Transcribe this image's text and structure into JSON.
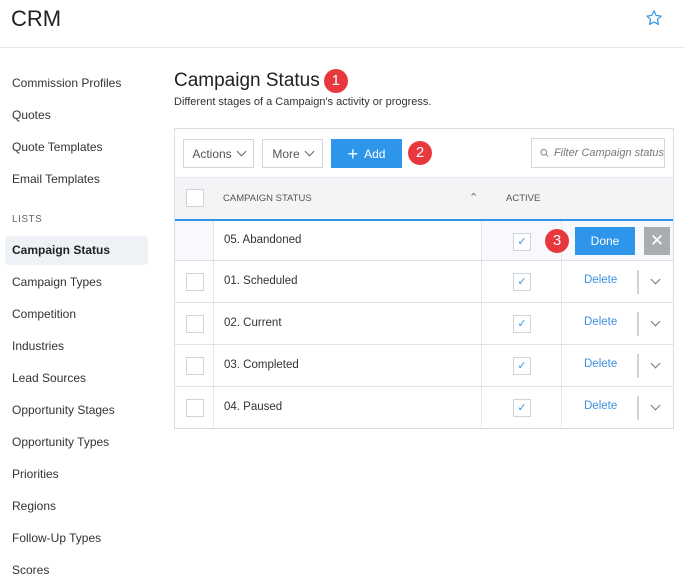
{
  "header": {
    "title": "CRM",
    "favorite_icon": "star-outline-icon"
  },
  "sidebar": {
    "items": [
      "Commission Profiles",
      "Quotes",
      "Quote Templates",
      "Email Templates"
    ],
    "section_label": "LISTS",
    "list_items": [
      "Campaign Status",
      "Campaign Types",
      "Competition",
      "Industries",
      "Lead Sources",
      "Opportunity Stages",
      "Opportunity Types",
      "Priorities",
      "Regions",
      "Follow-Up Types",
      "Scores"
    ],
    "active": "Campaign Status"
  },
  "main": {
    "title": "Campaign Status",
    "subtitle": "Different stages of a Campaign's activity or progress.",
    "badges": [
      "1",
      "2",
      "3"
    ],
    "toolbar": {
      "actions": "Actions",
      "more": "More",
      "add": "Add",
      "search_placeholder": "Filter Campaign status"
    },
    "columns": {
      "status": "CAMPAIGN STATUS",
      "active": "ACTIVE"
    },
    "edit_row": {
      "value": "05. Abandoned",
      "active": true,
      "done": "Done"
    },
    "rows": [
      {
        "name": "01. Scheduled",
        "active": true,
        "delete": "Delete"
      },
      {
        "name": "02. Current",
        "active": true,
        "delete": "Delete"
      },
      {
        "name": "03. Completed",
        "active": true,
        "delete": "Delete"
      },
      {
        "name": "04. Paused",
        "active": true,
        "delete": "Delete"
      }
    ],
    "accent": "#2d96ea"
  }
}
